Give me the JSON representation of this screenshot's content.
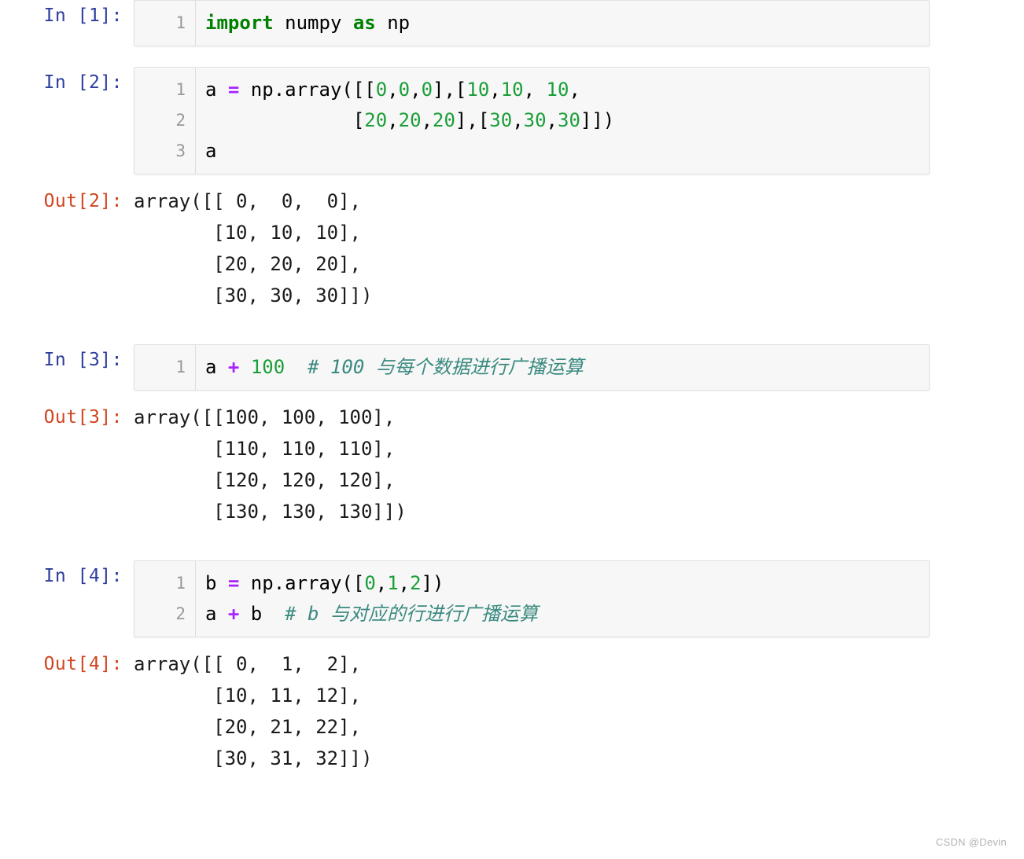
{
  "watermark": "CSDN @Devin",
  "colors": {
    "in_prompt": "#2d3d9c",
    "out_prompt": "#cf4520",
    "cell_background": "#f7f7f7",
    "cell_border": "#e2e2e2",
    "keyword": "#008000",
    "number": "#1a9e38",
    "operator": "#aa22ff",
    "comment": "#3a8a80",
    "page_background": "#ffffff"
  },
  "cells": [
    {
      "type": "code",
      "prompt": "In [1]:",
      "line_numbers": [
        "1"
      ],
      "lines": [
        [
          {
            "t": "import",
            "c": "kw"
          },
          {
            "t": " numpy ",
            "c": "pln"
          },
          {
            "t": "as",
            "c": "kw"
          },
          {
            "t": " np",
            "c": "pln"
          }
        ]
      ],
      "source": "import numpy as np"
    },
    {
      "type": "code",
      "prompt": "In [2]:",
      "line_numbers": [
        "1",
        "2",
        "3"
      ],
      "lines": [
        [
          {
            "t": "a ",
            "c": "pln"
          },
          {
            "t": "=",
            "c": "op"
          },
          {
            "t": " np.array([[",
            "c": "pln"
          },
          {
            "t": "0",
            "c": "num"
          },
          {
            "t": ",",
            "c": "pln"
          },
          {
            "t": "0",
            "c": "num"
          },
          {
            "t": ",",
            "c": "pln"
          },
          {
            "t": "0",
            "c": "num"
          },
          {
            "t": "],[",
            "c": "pln"
          },
          {
            "t": "10",
            "c": "num"
          },
          {
            "t": ",",
            "c": "pln"
          },
          {
            "t": "10",
            "c": "num"
          },
          {
            "t": ", ",
            "c": "pln"
          },
          {
            "t": "10",
            "c": "num"
          },
          {
            "t": ",",
            "c": "pln"
          }
        ],
        [
          {
            "t": "             [",
            "c": "pln"
          },
          {
            "t": "20",
            "c": "num"
          },
          {
            "t": ",",
            "c": "pln"
          },
          {
            "t": "20",
            "c": "num"
          },
          {
            "t": ",",
            "c": "pln"
          },
          {
            "t": "20",
            "c": "num"
          },
          {
            "t": "],[",
            "c": "pln"
          },
          {
            "t": "30",
            "c": "num"
          },
          {
            "t": ",",
            "c": "pln"
          },
          {
            "t": "30",
            "c": "num"
          },
          {
            "t": ",",
            "c": "pln"
          },
          {
            "t": "30",
            "c": "num"
          },
          {
            "t": "]])",
            "c": "pln"
          }
        ],
        [
          {
            "t": "a",
            "c": "pln"
          }
        ]
      ],
      "source": "a = np.array([[0,0,0],[10,10, 10],\n             [20,20,20],[30,30,30]])\na"
    },
    {
      "type": "output",
      "prompt": "Out[2]:",
      "lines": [
        "array([[ 0,  0,  0],",
        "       [10, 10, 10],",
        "       [20, 20, 20],",
        "       [30, 30, 30]])"
      ]
    },
    {
      "type": "code",
      "prompt": "In [3]:",
      "line_numbers": [
        "1"
      ],
      "lines": [
        [
          {
            "t": "a ",
            "c": "pln"
          },
          {
            "t": "+",
            "c": "op"
          },
          {
            "t": " ",
            "c": "pln"
          },
          {
            "t": "100",
            "c": "num"
          },
          {
            "t": "  ",
            "c": "pln"
          },
          {
            "t": "# 100 与每个数据进行广播运算",
            "c": "cmt"
          }
        ]
      ],
      "source": "a + 100  # 100 与每个数据进行广播运算"
    },
    {
      "type": "output",
      "prompt": "Out[3]:",
      "lines": [
        "array([[100, 100, 100],",
        "       [110, 110, 110],",
        "       [120, 120, 120],",
        "       [130, 130, 130]])"
      ]
    },
    {
      "type": "code",
      "prompt": "In [4]:",
      "line_numbers": [
        "1",
        "2"
      ],
      "lines": [
        [
          {
            "t": "b ",
            "c": "pln"
          },
          {
            "t": "=",
            "c": "op"
          },
          {
            "t": " np.array([",
            "c": "pln"
          },
          {
            "t": "0",
            "c": "num"
          },
          {
            "t": ",",
            "c": "pln"
          },
          {
            "t": "1",
            "c": "num"
          },
          {
            "t": ",",
            "c": "pln"
          },
          {
            "t": "2",
            "c": "num"
          },
          {
            "t": "])",
            "c": "pln"
          }
        ],
        [
          {
            "t": "a ",
            "c": "pln"
          },
          {
            "t": "+",
            "c": "op"
          },
          {
            "t": " b  ",
            "c": "pln"
          },
          {
            "t": "# b 与对应的行进行广播运算",
            "c": "cmt"
          }
        ]
      ],
      "source": "b = np.array([0,1,2])\na + b  # b 与对应的行进行广播运算"
    },
    {
      "type": "output",
      "prompt": "Out[4]:",
      "lines": [
        "array([[ 0,  1,  2],",
        "       [10, 11, 12],",
        "       [20, 21, 22],",
        "       [30, 31, 32]])"
      ]
    }
  ]
}
